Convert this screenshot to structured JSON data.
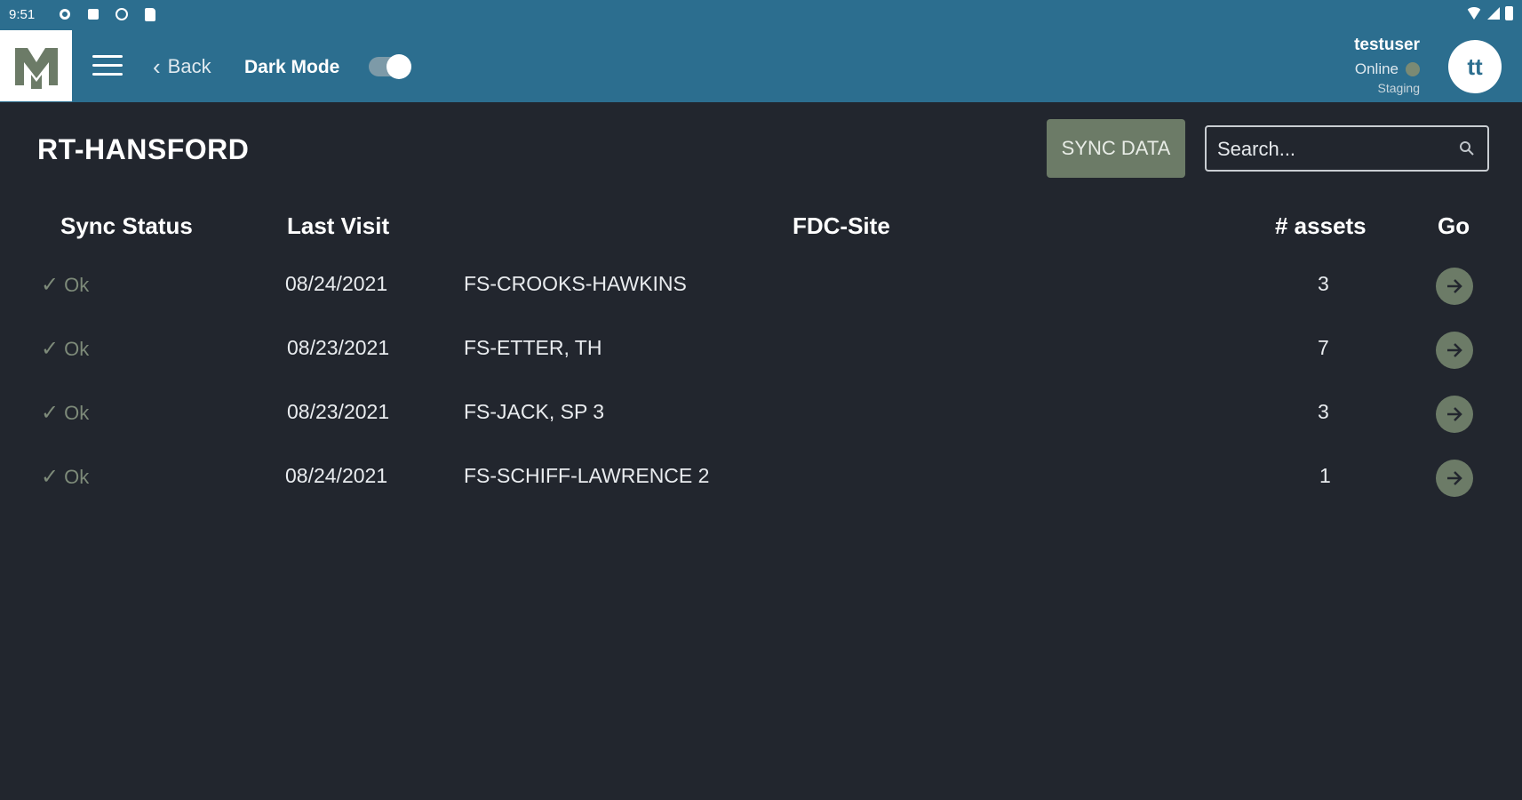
{
  "status_bar": {
    "time": "9:51"
  },
  "header": {
    "back_label": "Back",
    "dark_mode_label": "Dark Mode",
    "dark_mode_on": true,
    "user": {
      "name": "testuser",
      "status": "Online",
      "env": "Staging",
      "initials": "tt"
    }
  },
  "page": {
    "title": "RT-HANSFORD",
    "sync_button": "SYNC DATA",
    "search_placeholder": "Search..."
  },
  "table": {
    "columns": {
      "sync_status": "Sync Status",
      "last_visit": "Last Visit",
      "site": "FDC-Site",
      "assets": "# assets",
      "go": "Go"
    },
    "rows": [
      {
        "status": "Ok",
        "last_visit": "08/24/2021",
        "site": "FS-CROOKS-HAWKINS",
        "assets": "3"
      },
      {
        "status": "Ok",
        "last_visit": "08/23/2021",
        "site": "FS-ETTER, TH",
        "assets": "7"
      },
      {
        "status": "Ok",
        "last_visit": "08/23/2021",
        "site": "FS-JACK, SP 3",
        "assets": "3"
      },
      {
        "status": "Ok",
        "last_visit": "08/24/2021",
        "site": "FS-SCHIFF-LAWRENCE 2",
        "assets": "1"
      }
    ]
  },
  "colors": {
    "header": "#2c6e8f",
    "background": "#22262e",
    "accent": "#6c7b67",
    "status_ok": "#7d8a79"
  }
}
